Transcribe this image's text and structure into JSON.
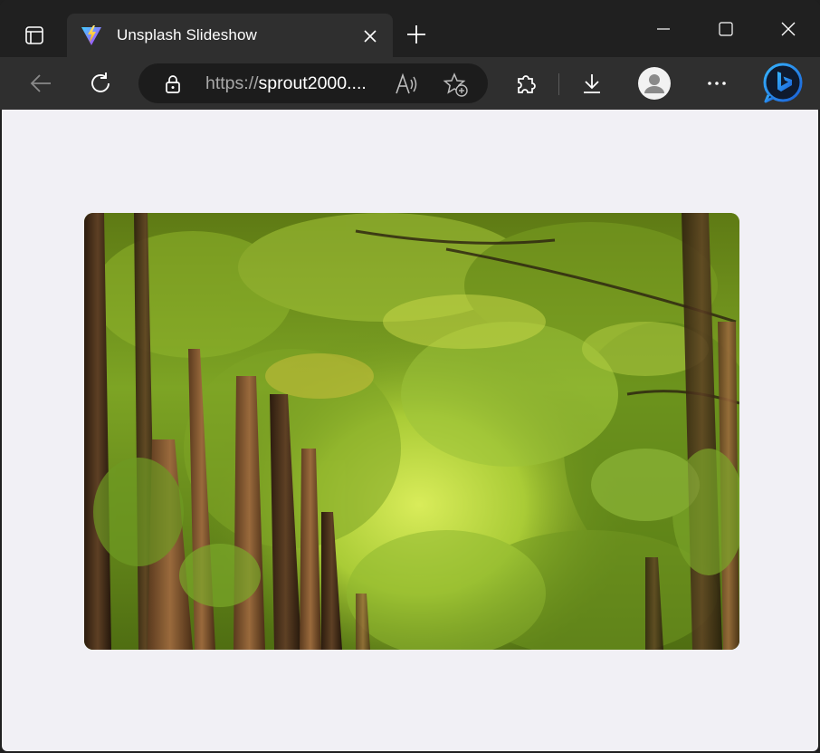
{
  "browser": {
    "tab": {
      "title": "Unsplash Slideshow",
      "favicon": "vite-logo-icon"
    },
    "address_bar": {
      "url_scheme": "https://",
      "url_host": "sprout2000...."
    },
    "icons": {
      "tab_actions": "tab-actions-icon",
      "close_tab": "close-icon",
      "new_tab": "plus-icon",
      "minimize": "minimize-icon",
      "maximize": "maximize-icon",
      "close_window": "close-icon",
      "back": "back-arrow-icon",
      "reload": "reload-icon",
      "lock": "lock-icon",
      "read_aloud": "read-aloud-icon",
      "add_favorite": "favorite-add-icon",
      "extensions": "puzzle-icon",
      "downloads": "download-icon",
      "profile": "profile-avatar-icon",
      "more": "more-icon",
      "copilot": "bing-icon"
    }
  },
  "page": {
    "slide_image": {
      "subject": "forest path under green tree canopy"
    }
  },
  "colors": {
    "titlebar": "#202020",
    "toolbar": "#2f2f2f",
    "omnibox": "#1c1c1c",
    "page_background": "#f1f0f5"
  }
}
